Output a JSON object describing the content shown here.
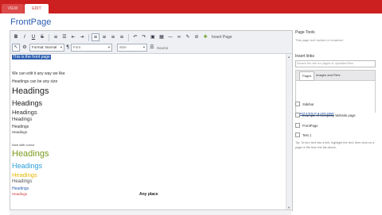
{
  "tabs": {
    "view": "VIEW",
    "edit": "EDIT"
  },
  "page_title": "FrontPage",
  "toolbar": {
    "insert_page_label": "Insert Page",
    "paragraph_format": "Format: Normal",
    "font_label": "Font",
    "size_label": "Size",
    "source_label": "Source"
  },
  "content": {
    "first_line": "This is the front page",
    "p1": "We can edit it any way we like",
    "p2": "Headings can be any size",
    "headings": [
      {
        "text": "Headings"
      },
      {
        "text": "Headings"
      },
      {
        "text": "Headings"
      },
      {
        "text": "Headings"
      },
      {
        "text": "Headings"
      },
      {
        "text": "Headings"
      }
    ],
    "colour_label": "Now with colour",
    "coloured": [
      {
        "text": "Headings",
        "color": "#7a9a1b"
      },
      {
        "text": "Headings",
        "color": "#2aa0d8"
      },
      {
        "text": "Headings",
        "color": "#e6b800"
      },
      {
        "text": "Headings",
        "color": "#555555"
      },
      {
        "text": "Headings",
        "color": "#2a5db0"
      },
      {
        "text": "Headings",
        "color": "#cc3333"
      }
    ],
    "any_place": "Any place"
  },
  "sidebar": {
    "title": "Page Tools",
    "subtitle": "This page isn't locked or renamed",
    "insert_links": "Insert links",
    "search_placeholder": "Search the site for pages or uploaded files",
    "tab_pages": "Pages",
    "tab_images": "Images and Files",
    "new_page_link": "Insert a link to a new page",
    "pages": [
      "Sidebar",
      "Example of Company Website page",
      "FrontPage",
      "Test 1"
    ],
    "hint": "Tip: To turn text into a link, highlight the text, then click on a page or file from the list above."
  },
  "colors": {
    "accent": "#cc1f1f",
    "link": "#2a5db0"
  }
}
